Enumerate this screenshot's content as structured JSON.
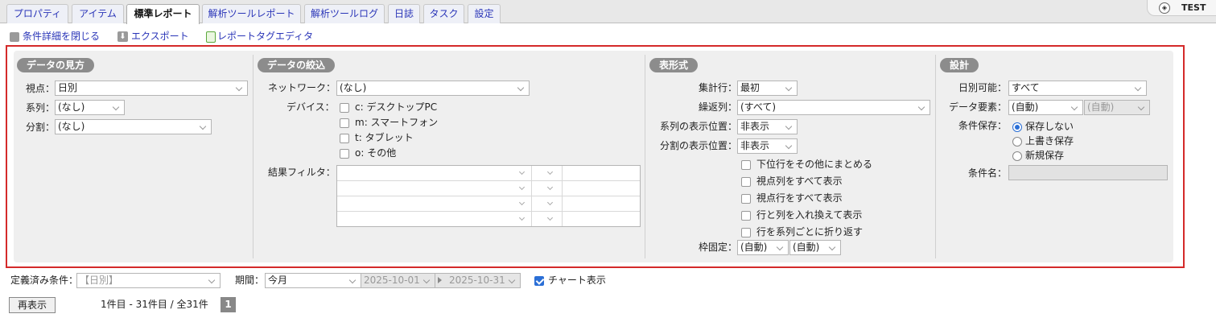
{
  "tabs": [
    {
      "label": "プロパティ"
    },
    {
      "label": "アイテム"
    },
    {
      "label": "標準レポート"
    },
    {
      "label": "解析ツールレポート"
    },
    {
      "label": "解析ツールログ"
    },
    {
      "label": "日誌"
    },
    {
      "label": "タスク"
    },
    {
      "label": "設定"
    }
  ],
  "env_label": "TEST",
  "toolbar": {
    "close_conditions": "条件詳細を閉じる",
    "export": "エクスポート",
    "tag_editor": "レポートタグエディタ"
  },
  "sections": {
    "view": {
      "title": "データの見方",
      "viewpoint_label": "視点：",
      "viewpoint_value": "日別",
      "series_label": "系列：",
      "series_value": "(なし)",
      "split_label": "分割：",
      "split_value": "(なし)"
    },
    "filter": {
      "title": "データの絞込",
      "network_label": "ネットワーク：",
      "network_value": "(なし)",
      "device_label": "デバイス：",
      "devices": [
        "c: デスクトップPC",
        "m: スマートフォン",
        "t: タブレット",
        "o: その他"
      ],
      "result_filter_label": "結果フィルタ："
    },
    "table": {
      "title": "表形式",
      "total_row_label": "集計行：",
      "total_row_value": "最初",
      "repeat_col_label": "繰返列：",
      "repeat_col_value": "(すべて)",
      "series_pos_label": "系列の表示位置：",
      "series_pos_value": "非表示",
      "split_pos_label": "分割の表示位置：",
      "split_pos_value": "非表示",
      "options": [
        "下位行をその他にまとめる",
        "視点列をすべて表示",
        "視点行をすべて表示",
        "行と列を入れ換えて表示",
        "行を系列ごとに折り返す"
      ],
      "freeze_label": "枠固定：",
      "freeze_value1": "(自動)",
      "freeze_value2": "(自動)"
    },
    "design": {
      "title": "設計",
      "daily_label": "日別可能：",
      "daily_value": "すべて",
      "element_label": "データ要素：",
      "element_value": "(自動)",
      "element_value2": "(自動)",
      "save_label": "条件保存：",
      "save_options": [
        "保存しない",
        "上書き保存",
        "新規保存"
      ],
      "name_label": "条件名："
    }
  },
  "bottom": {
    "defined_label": "定義済み条件：",
    "defined_placeholder": "【日別】",
    "period_label": "期間：",
    "period_value": "今月",
    "date_from": "2025-10-01",
    "date_to": "2025-10-31",
    "chart_label": "チャート表示",
    "redisplay_button": "再表示",
    "range_text": "1件目 - 31件目 / 全31件",
    "page_number": "1"
  }
}
